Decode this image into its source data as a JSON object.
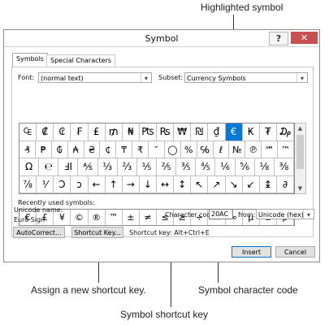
{
  "callouts": {
    "highlighted_symbol": "Highlighted symbol",
    "assign_shortcut": "Assign a new shortcut key.",
    "char_code": "Symbol character code",
    "shortcut_key": "Symbol shortcut key"
  },
  "dialog": {
    "title": "Symbol",
    "help": "?",
    "close": "✕",
    "tabs": [
      "Symbols",
      "Special Characters"
    ],
    "font_label": "Font:",
    "font_value": "(normal text)",
    "subset_label": "Subset:",
    "subset_value": "Currency Symbols",
    "symbols": [
      [
        "₠",
        "₡",
        "₢",
        "₣",
        "₤",
        "₥",
        "₦",
        "₧",
        "₨",
        "₩",
        "₪",
        "₫",
        "€",
        "₭",
        "₮",
        "₯"
      ],
      [
        "₰",
        "₱",
        "₲",
        "₳",
        "₴",
        "₵",
        "₸",
        "₹",
        "″",
        "◯",
        "%",
        "℅",
        "ℓ",
        "№",
        "℗",
        "℠",
        "™"
      ],
      [
        "Ω",
        "℮",
        "ℲI",
        "⅍",
        "⅓",
        "⅔",
        "⅕",
        "⅖",
        "⅗",
        "⅘",
        "⅙",
        "⅚",
        "⅛",
        "⅜"
      ],
      [
        "⅞",
        "⅟",
        "Ↄ",
        "ↄ",
        "←",
        "↑",
        "→",
        "↓",
        "↔",
        "↕",
        "↖",
        "↗",
        "↘",
        "↙",
        "↨",
        "∂"
      ]
    ],
    "recent_label": "Recently used symbols:",
    "recent": [
      "€",
      "£",
      "¥",
      "©",
      "®",
      "™",
      "±",
      "≠",
      "≤",
      "≥",
      "÷",
      "×",
      "∞",
      "µ",
      "α",
      "β"
    ],
    "unicode_name_label": "Unicode name:",
    "unicode_name": "Euro Sign",
    "char_code_label": "Character code:",
    "char_code": "20AC",
    "from_label": "from:",
    "from_value": "Unicode (hex)",
    "autocorrect": "AutoCorrect...",
    "shortcut_key_btn": "Shortcut Key...",
    "shortcut_text": "Shortcut key: Alt+Ctrl+E",
    "insert": "Insert",
    "cancel": "Cancel"
  },
  "colors": {
    "selection": "#0078d7",
    "close_bg": "#c75050"
  }
}
